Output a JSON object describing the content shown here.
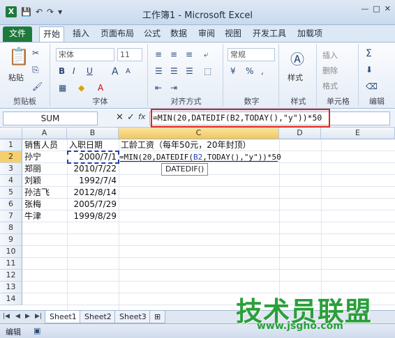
{
  "window": {
    "title": "工作簿1 - Microsoft Excel",
    "excel_logo": "X",
    "controls": [
      "—",
      "□",
      "✕"
    ]
  },
  "qat": {
    "save_icon": "💾",
    "undo_icon": "↶",
    "redo_icon": "↷",
    "customize_icon": "▾"
  },
  "tabs": [
    "文件",
    "开始",
    "插入",
    "页面布局",
    "公式",
    "数据",
    "审阅",
    "视图",
    "开发工具",
    "加载项"
  ],
  "ribbon": {
    "clipboard": {
      "label": "剪贴板",
      "paste": "粘贴"
    },
    "font": {
      "label": "字体",
      "name": "宋体",
      "size": "11",
      "bold": "B",
      "italic": "I",
      "underline": "U",
      "grow": "A",
      "shrink": "A"
    },
    "alignment": {
      "label": "对齐方式"
    },
    "number": {
      "label": "数字",
      "format": "常规",
      "percent": "%"
    },
    "styles": {
      "label": "样式",
      "style_btn": "样式"
    },
    "cells": {
      "label": "单元格",
      "insert": "插入",
      "delete": "删除",
      "format": "格式"
    },
    "editing": {
      "label": "编辑",
      "sigma": "Σ"
    }
  },
  "formula_bar": {
    "name_box": "SUM",
    "formula": "=MIN(20,DATEDIF(B2,TODAY(),\"y\"))*50",
    "cancel": "✕",
    "enter": "✓",
    "fx": "fx"
  },
  "grid": {
    "columns": [
      "A",
      "B",
      "C",
      "D",
      "E"
    ],
    "rows": [
      "1",
      "2",
      "3",
      "4",
      "5",
      "6",
      "7",
      "8",
      "9",
      "10",
      "11",
      "12",
      "13",
      "14"
    ],
    "cells": {
      "A1": "销售人员",
      "B1": "入职日期",
      "C1": "工龄工资（每年50元，20年封顶）",
      "A2": "孙宁",
      "B2": "2000/7/1",
      "A3": "郑丽",
      "B3": "2010/7/22",
      "A4": "刘颖",
      "B4": "1992/7/4",
      "A5": "孙洁飞",
      "B5": "2012/8/14",
      "A6": "张梅",
      "B6": "2005/7/29",
      "A7": "牛津",
      "B7": "1999/8/29"
    },
    "c2_editing": {
      "prefix": "=MIN(20,DATEDIF(",
      "ref": "B2",
      "suffix": ",TODAY(),\"y\"))*50"
    },
    "tooltip": "DATEDIF()"
  },
  "sheets": [
    "Sheet1",
    "Sheet2",
    "Sheet3"
  ],
  "status": {
    "mode": "编辑"
  },
  "watermark": {
    "logo": "技术员联盟",
    "url": "www.jsgho.com"
  }
}
